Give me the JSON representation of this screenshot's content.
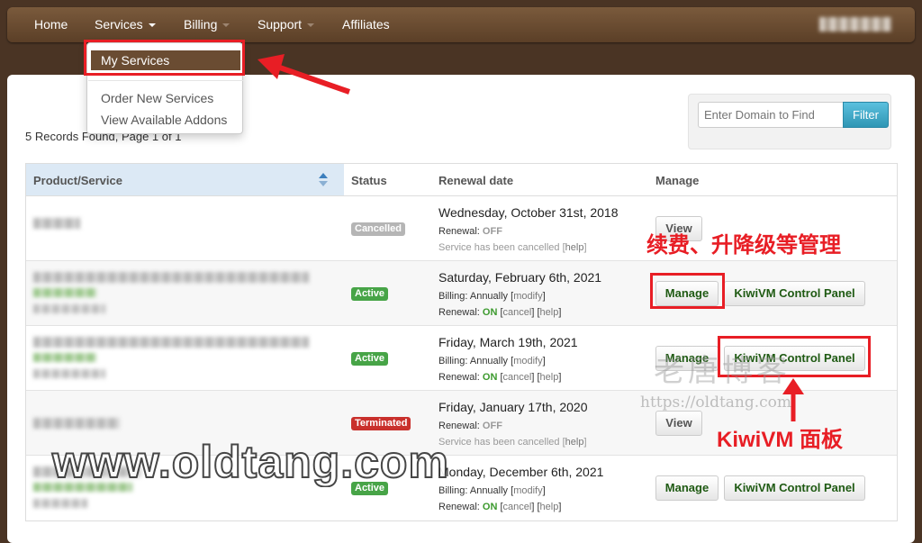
{
  "nav": {
    "items": [
      {
        "label": "Home",
        "caret": false
      },
      {
        "label": "Services",
        "caret": true
      },
      {
        "label": "Billing",
        "caret": true
      },
      {
        "label": "Support",
        "caret": true
      },
      {
        "label": "Affiliates",
        "caret": false
      }
    ]
  },
  "dropdown": {
    "items": [
      "My Services",
      "Order New Services",
      "View Available Addons"
    ],
    "active_index": 0
  },
  "records_text": "5 Records Found, Page 1 of 1",
  "filter": {
    "placeholder": "Enter Domain to Find",
    "button": "Filter"
  },
  "table": {
    "headers": [
      "Product/Service",
      "Status",
      "Renewal date",
      "Manage"
    ],
    "rows": [
      {
        "status": "Cancelled",
        "date": "Wednesday, October 31st, 2018",
        "renewal_label": "Renewal:",
        "renewal": "OFF",
        "note": "Service has been cancelled",
        "help": "help",
        "buttons": [
          "View"
        ]
      },
      {
        "status": "Active",
        "date": "Saturday, February 6th, 2021",
        "billing_label": "Billing:",
        "billing": "Annually",
        "modify": "modify",
        "renewal_label": "Renewal:",
        "renewal": "ON",
        "cancel": "cancel",
        "help": "help",
        "buttons": [
          "Manage",
          "KiwiVM Control Panel"
        ]
      },
      {
        "status": "Active",
        "date": "Friday, March 19th, 2021",
        "billing_label": "Billing:",
        "billing": "Annually",
        "modify": "modify",
        "renewal_label": "Renewal:",
        "renewal": "ON",
        "cancel": "cancel",
        "help": "help",
        "buttons": [
          "Manage",
          "KiwiVM Control Panel"
        ]
      },
      {
        "status": "Terminated",
        "date": "Friday, January 17th, 2020",
        "renewal_label": "Renewal:",
        "renewal": "OFF",
        "note": "Service has been cancelled",
        "help": "help",
        "buttons": [
          "View"
        ]
      },
      {
        "status": "Active",
        "date": "Monday, December 6th, 2021",
        "billing_label": "Billing:",
        "billing": "Annually",
        "modify": "modify",
        "renewal_label": "Renewal:",
        "renewal": "ON",
        "cancel": "cancel",
        "help": "help",
        "buttons": [
          "Manage",
          "KiwiVM Control Panel"
        ]
      }
    ]
  },
  "annotations": {
    "manage_note": "续费、升降级等管理",
    "panel_note": "KiwiVM 面板"
  },
  "watermarks": {
    "main": "www.oldtang.com",
    "cn": "老唐博客",
    "url": "https://oldtang.com"
  },
  "colors": {
    "accent": "#6a4c32",
    "annotation": "#e81e25",
    "active": "#47a447",
    "terminated": "#c9302c"
  }
}
